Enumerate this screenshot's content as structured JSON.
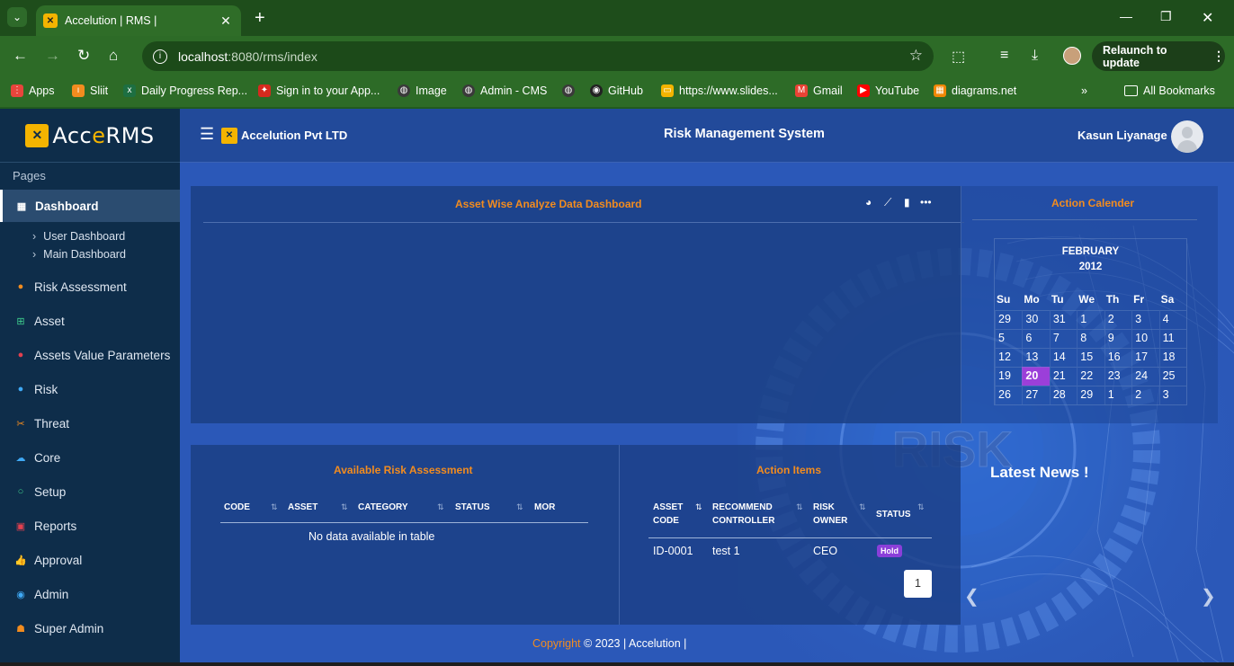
{
  "browser": {
    "tab_title": "Accelution | RMS |",
    "tab_close": "✕",
    "new_tab": "+",
    "url_host": "localhost",
    "url_path": ":8080/rms/index",
    "relaunch_label": "Relaunch to update",
    "bookmarks": [
      {
        "label": "Apps",
        "icon": "apps-grid-icon",
        "color": "#e8453c"
      },
      {
        "label": "Sliit",
        "icon": "sliit-icon",
        "color": "#f28c1f"
      },
      {
        "label": "Daily Progress Rep...",
        "icon": "excel-icon",
        "color": "#1d6f42"
      },
      {
        "label": "Sign in to your App...",
        "icon": "maple-leaf-icon",
        "color": "#d62a1e"
      },
      {
        "label": "Image",
        "icon": "globe-icon",
        "color": "#3a3a3a"
      },
      {
        "label": "Admin - CMS",
        "icon": "globe-icon",
        "color": "#3a3a3a"
      },
      {
        "label": "",
        "icon": "globe-icon",
        "color": "#3a3a3a"
      },
      {
        "label": "GitHub",
        "icon": "github-icon",
        "color": "#222222"
      },
      {
        "label": "https://www.slides...",
        "icon": "slides-icon",
        "color": "#f4b400"
      },
      {
        "label": "Gmail",
        "icon": "gmail-icon",
        "color": "#ea4335"
      },
      {
        "label": "YouTube",
        "icon": "youtube-icon",
        "color": "#ff0000"
      },
      {
        "label": "diagrams.net",
        "icon": "drawio-icon",
        "color": "#f08705"
      }
    ],
    "all_bookmarks": "All Bookmarks"
  },
  "app": {
    "brand_prefix": "Acc",
    "brand_accent": "e",
    "brand_suffix": "RMS",
    "company_name": "Accelution Pvt LTD",
    "system_title": "Risk Management System",
    "user_name": "Kasun Liyanage",
    "section_label": "Pages",
    "nav": [
      {
        "label": "Dashboard",
        "icon": "dashboard-icon",
        "active": true
      },
      {
        "label": "Risk Assessment",
        "icon": "flame-icon"
      },
      {
        "label": "Asset",
        "icon": "grid-icon"
      },
      {
        "label": "Assets Value Parameters",
        "icon": "bug-icon"
      },
      {
        "label": "Risk",
        "icon": "pin-icon"
      },
      {
        "label": "Threat",
        "icon": "scissors-icon"
      },
      {
        "label": "Core",
        "icon": "cloud-icon"
      },
      {
        "label": "Setup",
        "icon": "circle-icon"
      },
      {
        "label": "Reports",
        "icon": "report-icon"
      },
      {
        "label": "Approval",
        "icon": "thumbs-up-icon"
      },
      {
        "label": "Admin",
        "icon": "user-circle-icon"
      },
      {
        "label": "Super Admin",
        "icon": "users-icon"
      }
    ],
    "sub_nav": [
      "User Dashboard",
      "Main Dashboard"
    ]
  },
  "dashboard": {
    "analyze_title": "Asset Wise Analyze Data Dashboard",
    "calendar_title": "Action Calender",
    "calendar": {
      "month": "FEBRUARY",
      "year": "2012",
      "days_of_week": [
        "Su",
        "Mo",
        "Tu",
        "We",
        "Th",
        "Fr",
        "Sa"
      ],
      "weeks": [
        [
          "29",
          "30",
          "31",
          "1",
          "2",
          "3",
          "4"
        ],
        [
          "5",
          "6",
          "7",
          "8",
          "9",
          "10",
          "11"
        ],
        [
          "12",
          "13",
          "14",
          "15",
          "16",
          "17",
          "18"
        ],
        [
          "19",
          "20",
          "21",
          "22",
          "23",
          "24",
          "25"
        ],
        [
          "26",
          "27",
          "28",
          "29",
          "1",
          "2",
          "3"
        ]
      ],
      "selected": "20"
    },
    "risk_table": {
      "title": "Available Risk Assessment",
      "columns": [
        "CODE",
        "ASSET",
        "CATEGORY",
        "STATUS",
        "MOR"
      ],
      "empty_message": "No data available in table"
    },
    "actions_table": {
      "title": "Action Items",
      "columns": [
        [
          "ASSET",
          "CODE"
        ],
        [
          "RECOMMEND",
          "CONTROLLER"
        ],
        [
          "RISK",
          "OWNER"
        ],
        [
          "STATUS"
        ]
      ],
      "rows": [
        {
          "asset_code": "ID-0001",
          "controller": "test 1",
          "owner": "CEO",
          "status": "Hold"
        }
      ],
      "page": "1"
    },
    "news_title": "Latest News !",
    "background_word": "RISK"
  },
  "footer": {
    "link": "Copyright",
    "text": "© 2023 | Accelution |"
  },
  "colors": {
    "accent": "#f28c1f",
    "sidebar": "#0e2d4a",
    "selected_day": "#9b3fd9"
  }
}
